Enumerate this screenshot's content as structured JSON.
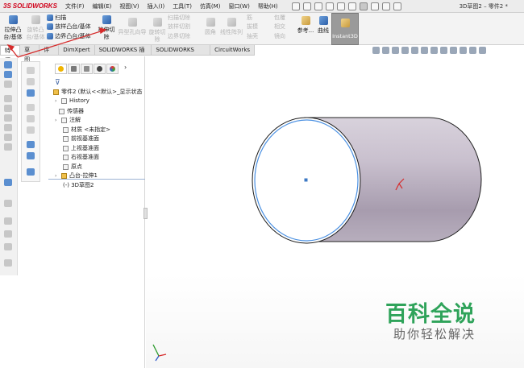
{
  "app": {
    "brand_prefix": "3S",
    "brand": "SOLIDWORKS",
    "window_title": "3D草图2 – 零件2 *"
  },
  "menu": [
    "文件(F)",
    "编辑(E)",
    "视图(V)",
    "插入(I)",
    "工具(T)",
    "仿真(M)",
    "窗口(W)",
    "帮助(H)"
  ],
  "ribbon": {
    "extrude_boss": "拉伸凸\n台/基体",
    "revolve_boss": "旋转凸\n台/基体",
    "sweep": "扫描",
    "loft_boss": "放样凸台/基体",
    "boundary_boss": "边界凸台/基体",
    "extrude_cut": "拉伸切\n除",
    "hole_wizard": "异型孔向导",
    "revolve_cut": "旋转切除",
    "swept_cut": "扫描切除",
    "lofted_cut": "放样切割",
    "boundary_cut": "边界切除",
    "fillet": "圆角",
    "linear_pattern": "线性阵列",
    "rib": "筋",
    "draft": "拔模",
    "shell": "抽壳",
    "wrap": "包覆",
    "intersect": "相交",
    "mirror": "镜向",
    "reference": "参考...",
    "curves": "曲线",
    "instant3d": "Instant3D"
  },
  "tabs": [
    "特征",
    "草图",
    "评估",
    "DimXpert",
    "SOLIDWORKS 插件",
    "SOLIDWORKS MBD",
    "CircuitWorks"
  ],
  "active_tab": "特征",
  "tree": {
    "part": "零件2 (默认<<默认>_显示状态",
    "history": "History",
    "sensors": "传感器",
    "annotations": "注解",
    "material": "材质 <未指定>",
    "front_plane": "前视基准面",
    "top_plane": "上视基准面",
    "right_plane": "右视基准面",
    "origin": "原点",
    "boss_extrude": "凸台-拉伸1",
    "sketch": "(-) 3D草图2"
  },
  "watermark": {
    "title": "百科全说",
    "subtitle": "助你轻松解决"
  },
  "colors": {
    "accent_blue": "#2d5fa8",
    "annotation_red": "#d62b2b",
    "watermark_green": "#2fa35a"
  }
}
